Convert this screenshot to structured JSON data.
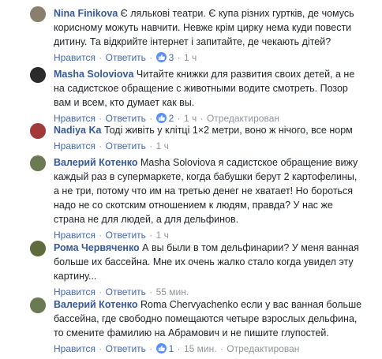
{
  "labels": {
    "like": "Нравится",
    "reply": "Ответить",
    "edited": "Отредактирован"
  },
  "comments": [
    {
      "author": "Nina Finikova",
      "text_lines": [
        "Є лялькові театри. Є купа різних гуртків, де чомусь",
        "корисному можуть навчити. Невже крім цирку нема куди повести",
        "дитину. Та відкрийте інтернет і запитайте, де чекають дітей?"
      ],
      "likes": "3",
      "time": "1 ч",
      "avatar_color": "#8a7f6e"
    },
    {
      "author": "Masha Soloviova",
      "text_lines": [
        "Читайте книжки для развития своих детей, а не",
        "на садистское обращение с животными водите смотреть. Позор",
        "вам и всем, кто думает как вы."
      ],
      "likes": "2",
      "time": "1 ч",
      "avatar_color": "#2b2b2b"
    },
    {
      "author": "Nadiya Ka",
      "text_lines": [
        "Тоді живіть у клітці 1×2 метри, воно ж нічого, все норм"
      ],
      "time": "1 ч",
      "avatar_color": "#a33a3a"
    },
    {
      "author": "Валерий Котенко",
      "text_lines": [
        "Masha Soloviova я садистское обращение вижу",
        "каждый раз в супермаркете, когда бабушки берут 2 картофелины,",
        "а не три, потому что им на третью денег не хватает! Но бороться",
        "надо не со скотским отношением к людям, правда? У нас же",
        "страна не для людей, а для дельфинов."
      ],
      "time": "1 ч",
      "avatar_color": "#6b7a52"
    },
    {
      "author": "Рома Червяченко",
      "text_lines": [
        "А вы были в том дельфинарии? У меня ванная",
        "больше их бассейна. Мне их очень жалко стало когда увидел эту",
        "картину..."
      ],
      "time": "55 мин.",
      "avatar_color": "#5d6b3f"
    },
    {
      "author": "Валерий Котенко",
      "text_lines": [
        "Roma Chervyachenko если у вас ванная больше",
        "бассейна, где свободно помещаются четыре взрослых дельфина,",
        "то смените фамилию на Абрамович и не пишите глупостей."
      ],
      "likes": "1",
      "time": "15 мин.",
      "avatar_color": "#6b7a52"
    }
  ]
}
